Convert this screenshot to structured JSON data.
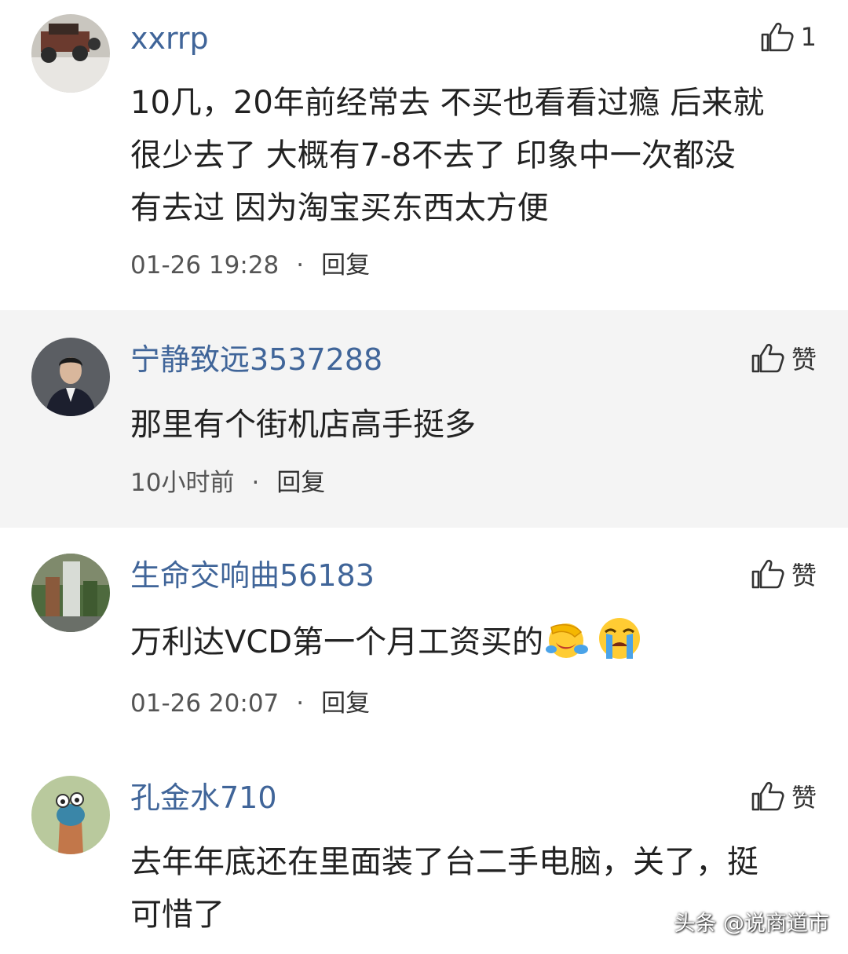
{
  "colors": {
    "username": "#406599",
    "text": "#222222",
    "meta": "#555555",
    "shaded_background": "#f4f4f4"
  },
  "comments": [
    {
      "username": "xxrrp",
      "like_label": "1",
      "text_lines": [
        "10几，20年前经常去 不买也看看过瘾 后来就",
        "很少去了 大概有7-8不去了 印象中一次都没",
        "有去过 因为淘宝买东西太方便"
      ],
      "time": "01-26 19:28",
      "separator": "·",
      "reply_label": "回复",
      "avatar_icon": "offroad-vehicle-avatar"
    },
    {
      "username": "宁静致远3537288",
      "like_label": "赞",
      "text": "那里有个街机店高手挺多",
      "time": "10小时前",
      "separator": "·",
      "reply_label": "回复",
      "avatar_icon": "man-in-suit-avatar"
    },
    {
      "username": "生命交响曲56183",
      "like_label": "赞",
      "text": "万利达VCD第一个月工资买的",
      "emojis": [
        "facepalm-laughing-emoji",
        "crying-emoji"
      ],
      "time": "01-26 20:07",
      "separator": "·",
      "reply_label": "回复",
      "avatar_icon": "waterfall-avatar"
    },
    {
      "username": "孔金水710",
      "like_label": "赞",
      "text_lines": [
        "去年年底还在里面装了台二手电脑，关了，挺",
        "可惜了"
      ],
      "avatar_icon": "cartoon-figure-avatar"
    }
  ],
  "icons": {
    "like": "thumbs-up-icon"
  },
  "watermark": "头条 @说商道市"
}
